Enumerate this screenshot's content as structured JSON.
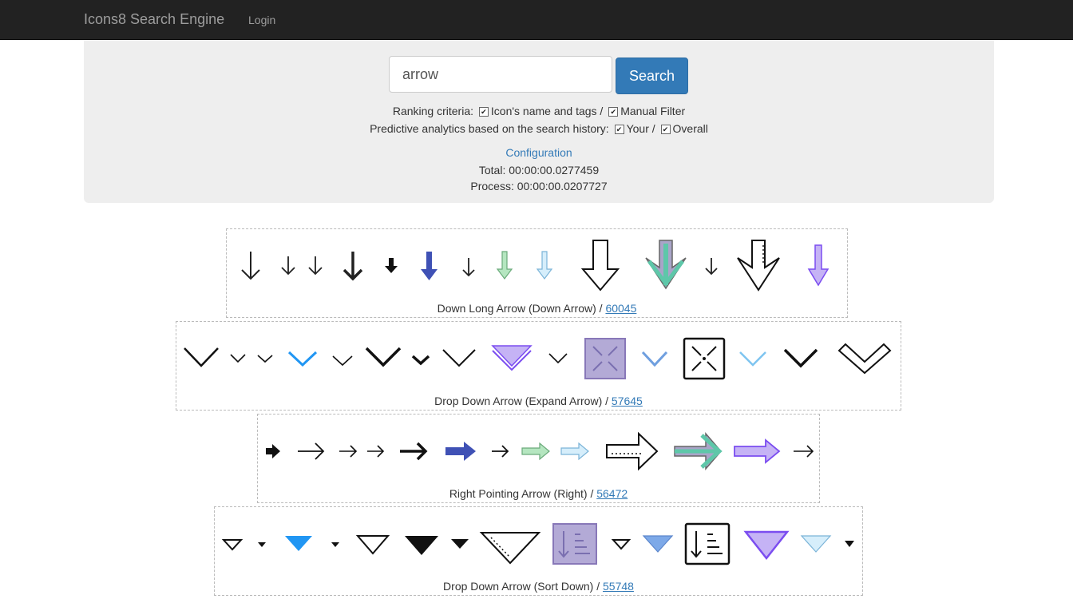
{
  "navbar": {
    "brand": "Icons8 Search Engine",
    "login": "Login"
  },
  "search": {
    "query": "arrow",
    "button": "Search"
  },
  "ranking": {
    "prefix": "Ranking criteria:",
    "opt1": "Icon's name and tags /",
    "opt2": "Manual Filter"
  },
  "predictive": {
    "prefix": "Predictive analytics based on the search history:",
    "opt1": "Your /",
    "opt2": "Overall"
  },
  "config_link": "Configuration",
  "timing": {
    "total": "Total: 00:00:00.0277459",
    "process": "Process: 00:00:00.0207727"
  },
  "colors": {
    "accent": "#337ab7",
    "navbar": "#222222",
    "panel": "#eeeeee"
  },
  "groups": [
    {
      "title": "Down Long Arrow (Down Arrow) /",
      "count": "60045",
      "icons": [
        "down-arrow-icon"
      ]
    },
    {
      "title": "Drop Down Arrow (Expand Arrow) /",
      "count": "57645",
      "icons": [
        "chevron-down-icon"
      ]
    },
    {
      "title": "Right Pointing Arrow (Right) /",
      "count": "56472",
      "icons": [
        "right-arrow-icon"
      ]
    },
    {
      "title": "Drop Down Arrow (Sort Down) /",
      "count": "55748",
      "icons": [
        "triangle-down-icon"
      ]
    }
  ]
}
